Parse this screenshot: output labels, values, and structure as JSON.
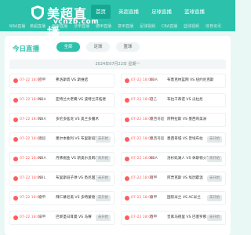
{
  "logo": {
    "title": "美超直播",
    "subtitle": "vcnzb.com"
  },
  "main_nav": [
    "首页",
    "英超直播",
    "足球直播",
    "篮球直播"
  ],
  "sub_nav": [
    "NBA直播",
    "英超直播",
    "西甲直播",
    "法甲直播",
    "德甲直播",
    "意甲直播",
    "足球视频",
    "CBA直播",
    "篮球视频",
    "体育资讯"
  ],
  "section": {
    "title": "今日直播",
    "filters": [
      "全部",
      "足球",
      "篮球"
    ],
    "date": "2024年07月22日 星期一"
  },
  "matches": [
    {
      "time": "07-22 18:00",
      "league": "巴甲",
      "teams": "弗洛斯塔 VS 斯维诺",
      "status": "",
      "state": "live"
    },
    {
      "time": "07-22 18:00",
      "league": "NBA",
      "teams": "布鲁克林篮网 VS 纽约尼克斯",
      "status": "",
      "state": "live"
    },
    {
      "time": "07-22 18:00",
      "league": "NBA",
      "teams": "亚特兰大老鹰 VS 波特兰开拓者",
      "status": "",
      "state": "live"
    },
    {
      "time": "07-22 18:00",
      "league": "巴乙",
      "teams": "布拉干蒂诺 VS 瓜拉尼",
      "status": "",
      "state": "live"
    },
    {
      "time": "07-22 18:00",
      "league": "NBA",
      "teams": "多伦多猛龙 VS 奥兰多魔术",
      "status": "",
      "state": "live"
    },
    {
      "time": "07-22 18:00",
      "league": "墨西哥超",
      "teams": "阿特拉斯 VS 墨西哥美洲",
      "status": "",
      "state": "live"
    },
    {
      "time": "07-22 18:00",
      "league": "澳超",
      "teams": "墨尔本胜利 VS 布里斯班狮吼",
      "status": "未开始",
      "state": "upcoming"
    },
    {
      "time": "07-22 18:00",
      "league": "墨西哥超",
      "teams": "墨西哥城 VS 普埃布拉",
      "status": "未开始",
      "state": "upcoming"
    },
    {
      "time": "07-22 18:00",
      "league": "NBA",
      "teams": "丹佛掘金 VS 新奥尔良鹈鹕",
      "status": "未开始",
      "state": "upcoming"
    },
    {
      "time": "07-22 18:00",
      "league": "NBA",
      "teams": "洛杉矶湖人 VS 休斯顿火箭",
      "status": "未开始",
      "state": "upcoming"
    },
    {
      "time": "07-22 18:00",
      "league": "NBL",
      "teams": "布里斯班子弹 VS 悉尼国王",
      "status": "未开始",
      "state": "upcoming"
    },
    {
      "time": "07-22 18:00",
      "league": "荷甲",
      "teams": "阿贾克斯 VS 埃因霍温",
      "status": "未开始",
      "state": "upcoming"
    },
    {
      "time": "07-22 18:00",
      "league": "德甲",
      "teams": "拜仁慕尼黑 VS 多特蒙德",
      "status": "未开始",
      "state": "upcoming"
    },
    {
      "time": "07-22 18:00",
      "league": "意甲",
      "teams": "国际米兰 VS AC米兰",
      "status": "未开始",
      "state": "upcoming"
    },
    {
      "time": "07-22 18:00",
      "league": "法甲",
      "teams": "巴黎圣日耳曼 VS 马赛",
      "status": "未开始",
      "state": "upcoming"
    },
    {
      "time": "07-22 18:00",
      "league": "西甲",
      "teams": "皇家马德里 VS 巴塞罗那",
      "status": "未开始",
      "state": "upcoming"
    }
  ],
  "colors": {
    "brand": "#2bc1ab",
    "live": "#ff5d5d",
    "background": "#e9f7f5"
  }
}
